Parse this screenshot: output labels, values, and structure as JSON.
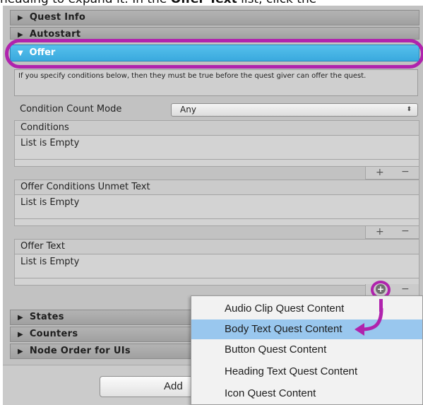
{
  "doc_top": {
    "text_a": "heading to expand it. In the ",
    "text_b": "Offer Text",
    "text_c": " list, click the"
  },
  "sections": {
    "quest_info": "Quest Info",
    "autostart": "Autostart",
    "offer": "Offer",
    "states": "States",
    "counters": "Counters",
    "node_order": "Node Order for UIs"
  },
  "offer": {
    "help_text": "If you specify conditions below, then they must be true before the quest giver can offer the quest.",
    "condition_count_mode_label": "Condition Count Mode",
    "condition_count_mode_value": "Any",
    "lists": [
      {
        "header": "Conditions",
        "empty_text": "List is Empty"
      },
      {
        "header": "Offer Conditions Unmet Text",
        "empty_text": "List is Empty"
      },
      {
        "header": "Offer Text",
        "empty_text": "List is Empty"
      }
    ],
    "plus_symbol": "+",
    "minus_symbol": "−"
  },
  "menu": {
    "items": [
      "Audio Clip Quest Content",
      "Body Text Quest Content",
      "Button Quest Content",
      "Heading Text Quest Content",
      "Icon Quest Content"
    ],
    "highlighted_index": 1
  },
  "add_button": {
    "label": "Add"
  },
  "colors": {
    "highlight_ring": "#b023ad",
    "offer_header": "#45b4e5",
    "menu_highlight": "#99c7ee"
  }
}
